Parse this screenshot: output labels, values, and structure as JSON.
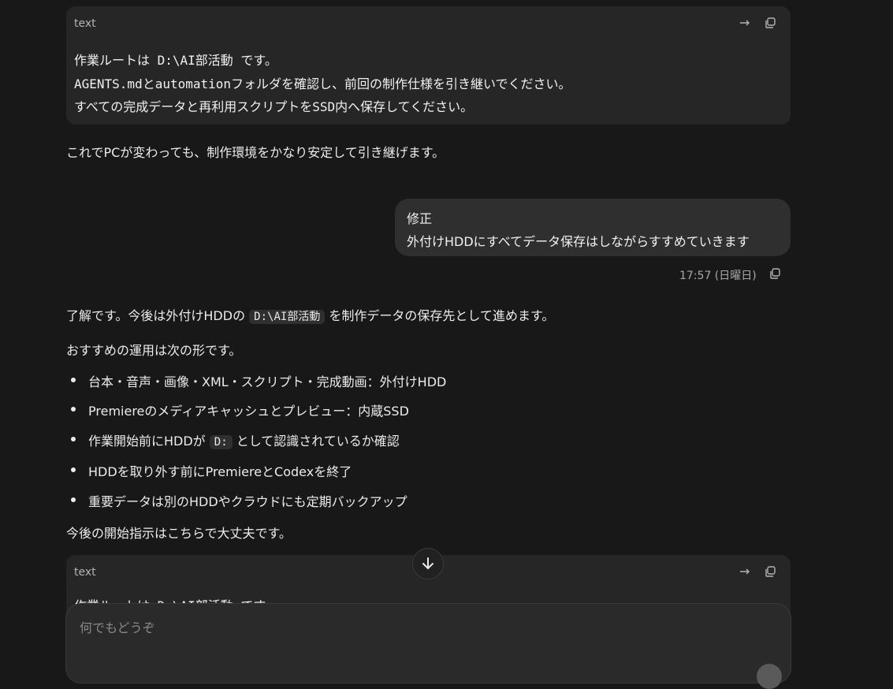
{
  "code_block_1": {
    "lang": "text",
    "lines": [
      "作業ルートは D:\\AI部活動 です。",
      "AGENTS.mdとautomationフォルダを確認し、前回の制作仕様を引き継いでください。",
      "すべての完成データと再利用スクリプトをSSD内へ保存してください。"
    ],
    "wrap_icon": "wrap-arrow-icon",
    "copy_icon": "copy-icon"
  },
  "assistant_text_1": "これでPCが変わっても、制作環境をかなり安定して引き継げます。",
  "user_message": {
    "lines": [
      "修正",
      "外付けHDDにすべてデータ保存はしながらすすめていきます"
    ],
    "timestamp": "17:57 (日曜日)"
  },
  "assistant_reply": {
    "intro_before": "了解です。今後は外付けHDDの",
    "intro_code": "D:\\AI部活動",
    "intro_after": "を制作データの保存先として進めます。",
    "recommend": "おすすめの運用は次の形です。",
    "bullets": [
      {
        "text": "台本・音声・画像・XML・スクリプト・完成動画：外付けHDD"
      },
      {
        "text": "Premiereのメディアキャッシュとプレビュー：内蔵SSD"
      },
      {
        "before": "作業開始前にHDDが",
        "code": "D:",
        "after": "として認識されているか確認"
      },
      {
        "text": "HDDを取り外す前にPremiereとCodexを終了"
      },
      {
        "text": "重要データは別のHDDやクラウドにも定期バックアップ"
      }
    ],
    "closing": "今後の開始指示はこちらで大丈夫です。"
  },
  "code_block_2": {
    "lang": "text",
    "partial_line": "作業ルートは D:\\AI部活動 です。"
  },
  "composer": {
    "placeholder": "何でもどうぞ"
  },
  "colors": {
    "background": "#181818",
    "code_block": "#262626",
    "user_bubble": "#2f2f2f",
    "text": "#ececec"
  }
}
